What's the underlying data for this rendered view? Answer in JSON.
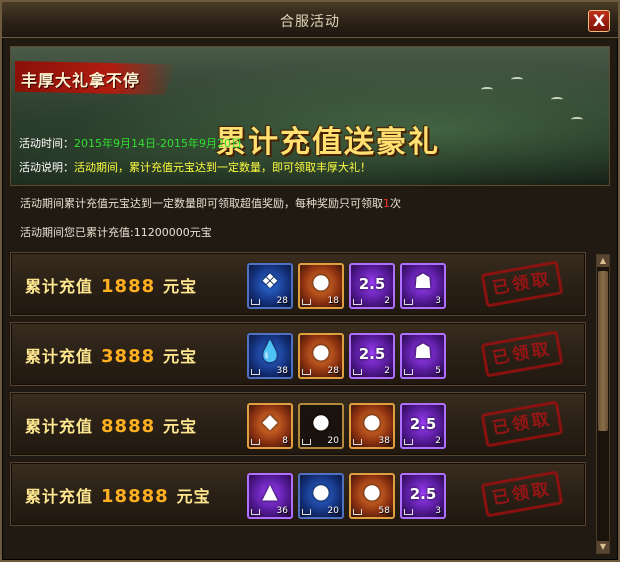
{
  "window": {
    "title": "合服活动",
    "close_label": "X"
  },
  "banner": {
    "tag": "丰厚大礼拿不停",
    "headline": "累计充值送豪礼"
  },
  "info": {
    "time_label": "活动时间：",
    "time_value": "2015年9月14日-2015年9月20日",
    "desc_label": "活动说明：",
    "desc_value": "活动期间，累计充值元宝达到一定数量，即可领取丰厚大礼！"
  },
  "notice": {
    "text_a": "活动期间累计充值元宝达到一定数量即可领取超值奖励，每种奖励只可领取",
    "limit": "1",
    "text_b": "次",
    "total_label": "活动期间您已累计充值:",
    "total_value": "11200000",
    "total_unit": "元宝"
  },
  "tiers": [
    {
      "label": "累计充值",
      "amount": "1888",
      "unit": "元宝",
      "status": "已领取",
      "items": [
        {
          "icon": "blue-crystal-icon",
          "quality": "blue",
          "count": "28"
        },
        {
          "icon": "red-orb-icon",
          "quality": "orange",
          "count": "18"
        },
        {
          "icon": "exp-2.5-icon",
          "quality": "purple",
          "count": "2",
          "text": "2.5"
        },
        {
          "icon": "dark-cloak-icon",
          "quality": "purple",
          "count": "3"
        }
      ]
    },
    {
      "label": "累计充值",
      "amount": "3888",
      "unit": "元宝",
      "status": "已领取",
      "items": [
        {
          "icon": "water-drop-icon",
          "quality": "blue",
          "count": "38"
        },
        {
          "icon": "red-orb-icon",
          "quality": "orange",
          "count": "28"
        },
        {
          "icon": "exp-2.5-icon",
          "quality": "purple",
          "count": "2",
          "text": "2.5"
        },
        {
          "icon": "dark-cloak-icon",
          "quality": "purple",
          "count": "5"
        }
      ]
    },
    {
      "label": "累计充值",
      "amount": "8888",
      "unit": "元宝",
      "status": "已领取",
      "items": [
        {
          "icon": "gold-crystal-icon",
          "quality": "orange",
          "count": "8"
        },
        {
          "icon": "green-orb-icon",
          "quality": "plain",
          "count": "20"
        },
        {
          "icon": "red-orb-icon",
          "quality": "orange",
          "count": "38"
        },
        {
          "icon": "exp-2.5-icon",
          "quality": "purple",
          "count": "2",
          "text": "2.5"
        }
      ]
    },
    {
      "label": "累计充值",
      "amount": "18888",
      "unit": "元宝",
      "status": "已领取",
      "items": [
        {
          "icon": "flame-icon",
          "quality": "purple",
          "count": "36"
        },
        {
          "icon": "blue-orb-icon",
          "quality": "blue",
          "count": "20"
        },
        {
          "icon": "red-orb-icon",
          "quality": "orange",
          "count": "58"
        },
        {
          "icon": "exp-2.5-icon",
          "quality": "purple",
          "count": "3",
          "text": "2.5"
        }
      ]
    }
  ]
}
